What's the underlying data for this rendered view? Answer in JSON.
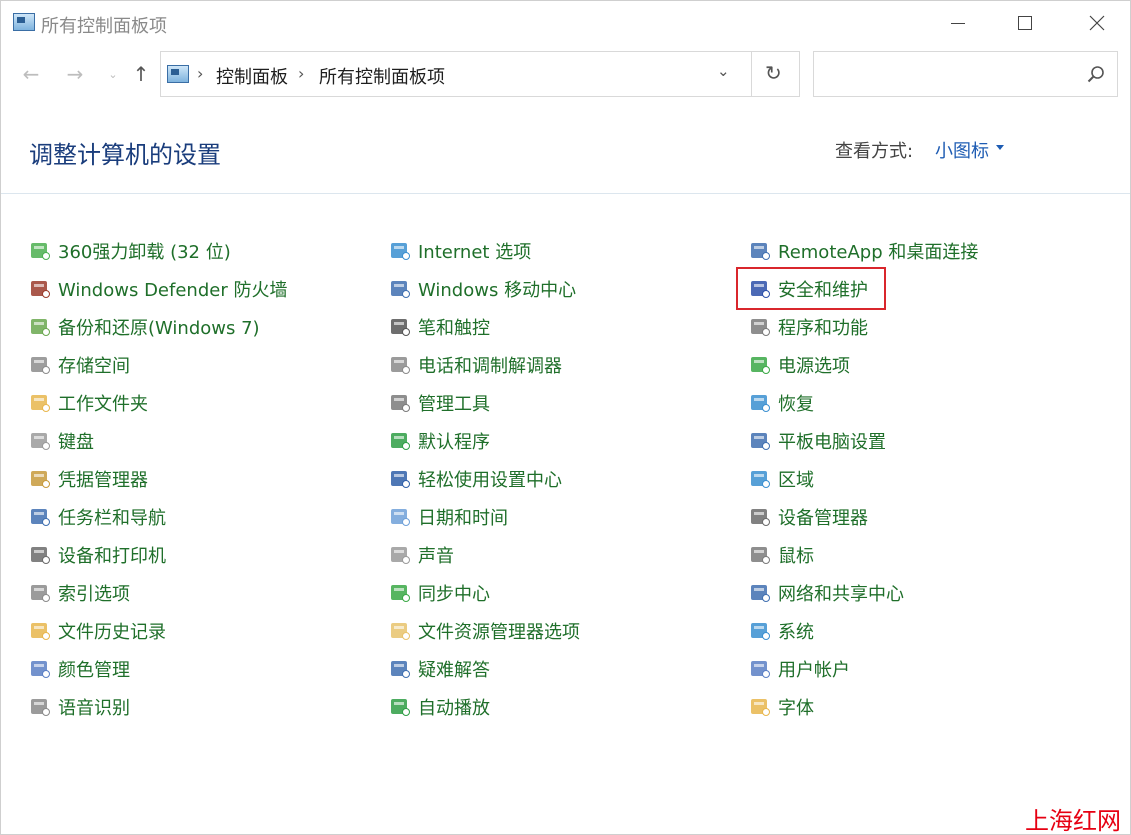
{
  "window": {
    "title": "所有控制面板项",
    "controls": {
      "minimize": "—",
      "maximize": "☐",
      "close": "✕"
    }
  },
  "nav": {
    "back": "←",
    "forward": "→",
    "recent": "⌄",
    "up": "↑",
    "breadcrumb": [
      "控制面板",
      "所有控制面板项"
    ],
    "separator": "›",
    "dropdown": "⌄",
    "refresh": "↻",
    "search_placeholder": ""
  },
  "header": {
    "title": "调整计算机的设置",
    "view_label": "查看方式:",
    "view_value": "小图标"
  },
  "columns": [
    [
      {
        "label": "360强力卸载 (32 位)",
        "icon": "uninstall-icon",
        "color": "#4caf50"
      },
      {
        "label": "Windows Defender 防火墙",
        "icon": "firewall-icon",
        "color": "#9b3b2b"
      },
      {
        "label": "备份和还原(Windows 7)",
        "icon": "backup-icon",
        "color": "#6aa84f"
      },
      {
        "label": "存储空间",
        "icon": "storage-icon",
        "color": "#8c8c8c"
      },
      {
        "label": "工作文件夹",
        "icon": "work-folder-icon",
        "color": "#e8b64c"
      },
      {
        "label": "键盘",
        "icon": "keyboard-icon",
        "color": "#9a9a9a"
      },
      {
        "label": "凭据管理器",
        "icon": "credential-icon",
        "color": "#c79a3c"
      },
      {
        "label": "任务栏和导航",
        "icon": "taskbar-icon",
        "color": "#3f6fb0"
      },
      {
        "label": "设备和打印机",
        "icon": "printer-icon",
        "color": "#6b6b6b"
      },
      {
        "label": "索引选项",
        "icon": "index-icon",
        "color": "#8a8a8a"
      },
      {
        "label": "文件历史记录",
        "icon": "file-history-icon",
        "color": "#e8b64c"
      },
      {
        "label": "颜色管理",
        "icon": "color-management-icon",
        "color": "#5b7fc4"
      },
      {
        "label": "语音识别",
        "icon": "microphone-icon",
        "color": "#8a8a8a"
      }
    ],
    [
      {
        "label": "Internet 选项",
        "icon": "internet-icon",
        "color": "#3a8fd0"
      },
      {
        "label": "Windows 移动中心",
        "icon": "mobility-center-icon",
        "color": "#3f6fb0"
      },
      {
        "label": "笔和触控",
        "icon": "pen-icon",
        "color": "#555555"
      },
      {
        "label": "电话和调制解调器",
        "icon": "phone-modem-icon",
        "color": "#8a8a8a"
      },
      {
        "label": "管理工具",
        "icon": "admin-tools-icon",
        "color": "#7a7a7a"
      },
      {
        "label": "默认程序",
        "icon": "default-programs-icon",
        "color": "#2e9e44"
      },
      {
        "label": "轻松使用设置中心",
        "icon": "ease-of-access-icon",
        "color": "#2f5fa8"
      },
      {
        "label": "日期和时间",
        "icon": "datetime-icon",
        "color": "#6fa0d8"
      },
      {
        "label": "声音",
        "icon": "sound-icon",
        "color": "#9a9a9a"
      },
      {
        "label": "同步中心",
        "icon": "sync-icon",
        "color": "#3aa845"
      },
      {
        "label": "文件资源管理器选项",
        "icon": "explorer-options-icon",
        "color": "#e8c36c"
      },
      {
        "label": "疑难解答",
        "icon": "troubleshoot-icon",
        "color": "#3f6fb0"
      },
      {
        "label": "自动播放",
        "icon": "autoplay-icon",
        "color": "#2e9e44"
      }
    ],
    [
      {
        "label": "RemoteApp 和桌面连接",
        "icon": "remoteapp-icon",
        "color": "#3f6fb0"
      },
      {
        "label": "安全和维护",
        "icon": "flag-icon",
        "color": "#2b4fa8"
      },
      {
        "label": "程序和功能",
        "icon": "programs-icon",
        "color": "#7a7a7a"
      },
      {
        "label": "电源选项",
        "icon": "power-icon",
        "color": "#3aa845"
      },
      {
        "label": "恢复",
        "icon": "recovery-icon",
        "color": "#3a8fd0"
      },
      {
        "label": "平板电脑设置",
        "icon": "tablet-icon",
        "color": "#3f6fb0"
      },
      {
        "label": "区域",
        "icon": "region-icon",
        "color": "#3a8fd0"
      },
      {
        "label": "设备管理器",
        "icon": "device-manager-icon",
        "color": "#6b6b6b"
      },
      {
        "label": "鼠标",
        "icon": "mouse-icon",
        "color": "#7a7a7a"
      },
      {
        "label": "网络和共享中心",
        "icon": "network-icon",
        "color": "#3f6fb0"
      },
      {
        "label": "系统",
        "icon": "system-icon",
        "color": "#3a8fd0"
      },
      {
        "label": "用户帐户",
        "icon": "user-accounts-icon",
        "color": "#5b7fc4"
      },
      {
        "label": "字体",
        "icon": "fonts-icon",
        "color": "#e8b64c"
      }
    ]
  ],
  "highlighted_item": "安全和维护",
  "watermark": "上海红网"
}
